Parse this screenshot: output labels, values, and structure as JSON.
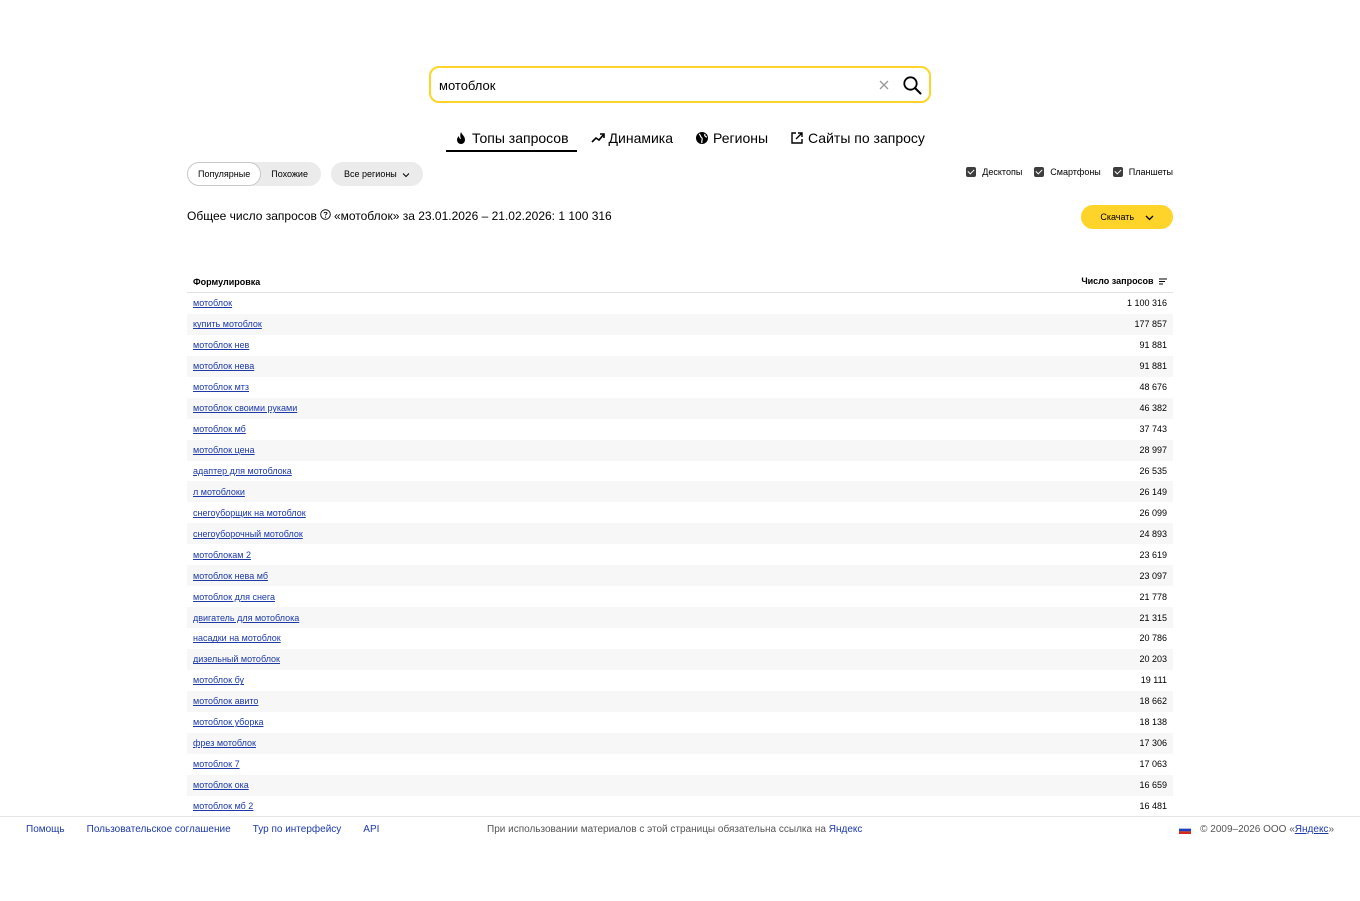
{
  "search": {
    "value": "мотоблок",
    "accent_color": "#fed42b"
  },
  "tabs": [
    {
      "label": "Топы запросов",
      "icon": "flame-icon",
      "active": true
    },
    {
      "label": "Динамика",
      "icon": "trend-up-icon"
    },
    {
      "label": "Регионы",
      "icon": "globe-icon"
    },
    {
      "label": "Сайты по запросу",
      "icon": "external-link-icon"
    }
  ],
  "mode": {
    "popular": "Популярные",
    "similar": "Похожие",
    "selected": "Популярные"
  },
  "regions_label": "Все регионы",
  "devices": {
    "desktop": "Десктопы",
    "smartphone": "Смартфоны",
    "tablet": "Планшеты"
  },
  "total": {
    "prefix": "Общее число запросов",
    "text": "«мотоблок» за 23.01.2026 – 21.02.2026: 1 100 316"
  },
  "download_label": "Скачать",
  "table": {
    "col_phrase": "Формулировка",
    "col_count": "Число запросов",
    "rows": [
      {
        "phrase": "мотоблок",
        "count": "1 100 316"
      },
      {
        "phrase": "купить мотоблок",
        "count": "177 857"
      },
      {
        "phrase": "мотоблок нев",
        "count": "91 881"
      },
      {
        "phrase": "мотоблок нева",
        "count": "91 881"
      },
      {
        "phrase": "мотоблок мтз",
        "count": "48 676"
      },
      {
        "phrase": "мотоблок своими руками",
        "count": "46 382"
      },
      {
        "phrase": "мотоблок мб",
        "count": "37 743"
      },
      {
        "phrase": "мотоблок цена",
        "count": "28 997"
      },
      {
        "phrase": "адаптер для мотоблока",
        "count": "26 535"
      },
      {
        "phrase": "л мотоблоки",
        "count": "26 149"
      },
      {
        "phrase": "снегоуборщик на мотоблок",
        "count": "26 099"
      },
      {
        "phrase": "снегоуборочный мотоблок",
        "count": "24 893"
      },
      {
        "phrase": "мотоблокам 2",
        "count": "23 619"
      },
      {
        "phrase": "мотоблок нева мб",
        "count": "23 097"
      },
      {
        "phrase": "мотоблок для снега",
        "count": "21 778"
      },
      {
        "phrase": "двигатель для мотоблока",
        "count": "21 315"
      },
      {
        "phrase": "насадки на мотоблок",
        "count": "20 786"
      },
      {
        "phrase": "дизельный мотоблок",
        "count": "20 203"
      },
      {
        "phrase": "мотоблок бу",
        "count": "19 111"
      },
      {
        "phrase": "мотоблок авито",
        "count": "18 662"
      },
      {
        "phrase": "мотоблок уборка",
        "count": "18 138"
      },
      {
        "phrase": "фрез мотоблок",
        "count": "17 306"
      },
      {
        "phrase": "мотоблок 7",
        "count": "17 063"
      },
      {
        "phrase": "мотоблок ока",
        "count": "16 659"
      },
      {
        "phrase": "мотоблок мб 2",
        "count": "16 481"
      }
    ]
  },
  "footer": {
    "help": "Помощь",
    "agreement": "Пользовательское соглашение",
    "tour": "Тур по интерфейсу",
    "api": "API",
    "notice": "При использовании материалов с этой страницы обязательна ссылка на",
    "notice_link": "Яндекс",
    "copyright_prefix": "© 2009–2026 ООО «",
    "copyright_link": "Яндекс",
    "copyright_suffix": "»",
    "link_color": "#1d3aa8"
  }
}
